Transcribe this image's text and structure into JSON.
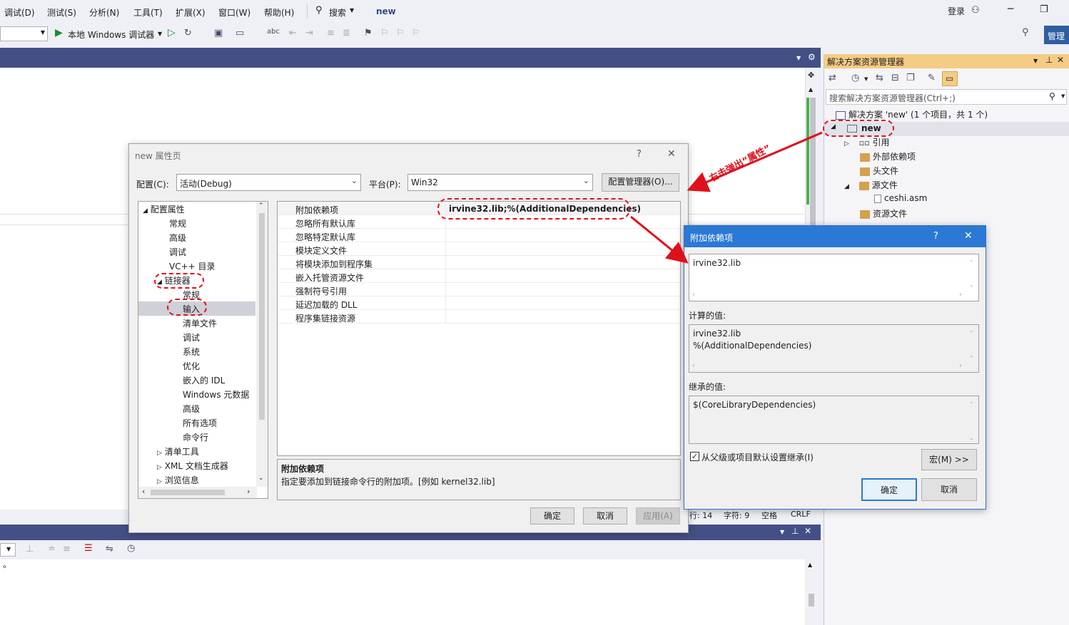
{
  "menu": [
    "调试(D)",
    "测试(S)",
    "分析(N)",
    "工具(T)",
    "扩展(X)",
    "窗口(W)",
    "帮助(H)"
  ],
  "search_label": "搜索",
  "project_name_top": "new",
  "login_label": "登录",
  "admin_label": "管理",
  "debug_target": "本地 Windows 调试器",
  "solution_explorer": {
    "title": "解决方案资源管理器",
    "search_placeholder": "搜索解决方案资源管理器(Ctrl+;)",
    "solution_row": "解决方案 'new' (1 个项目，共 1 个)",
    "project": "new",
    "items": [
      "引用",
      "外部依赖项",
      "头文件",
      "源文件",
      "ceshi.asm",
      "资源文件"
    ]
  },
  "annotation": {
    "text": "右击弹出“属性”"
  },
  "prop_dialog": {
    "title": "new 属性页",
    "help": "?",
    "close": "✕",
    "config_label": "配置(C):",
    "config_value": "活动(Debug)",
    "platform_label": "平台(P):",
    "platform_value": "Win32",
    "config_manager": "配置管理器(O)...",
    "nav": {
      "root": "配置属性",
      "general": "常规",
      "advanced": "高级",
      "debugging": "调试",
      "vcdirs": "VC++ 目录",
      "linker": "链接器",
      "linker_children": [
        "常规",
        "输入",
        "清单文件",
        "调试",
        "系统",
        "优化",
        "嵌入的 IDL",
        "Windows 元数据",
        "高级",
        "所有选项",
        "命令行"
      ],
      "manifest_tool": "清单工具",
      "xml_doc": "XML 文档生成器",
      "browse": "浏览信息"
    },
    "grid_rows": [
      {
        "name": "附加依赖项",
        "value": "irvine32.lib;%(AdditionalDependencies)"
      },
      {
        "name": "忽略所有默认库",
        "value": ""
      },
      {
        "name": "忽略特定默认库",
        "value": ""
      },
      {
        "name": "模块定义文件",
        "value": ""
      },
      {
        "name": "将模块添加到程序集",
        "value": ""
      },
      {
        "name": "嵌入托管资源文件",
        "value": ""
      },
      {
        "name": "强制符号引用",
        "value": ""
      },
      {
        "name": "延迟加载的 DLL",
        "value": ""
      },
      {
        "name": "程序集链接资源",
        "value": ""
      }
    ],
    "desc_title": "附加依赖项",
    "desc_text": "指定要添加到链接命令行的附加项。[例如 kernel32.lib]",
    "ok": "确定",
    "cancel": "取消",
    "apply": "应用(A)"
  },
  "dep_dialog": {
    "title": "附加依赖项",
    "help": "?",
    "close": "✕",
    "input_value": "irvine32.lib",
    "computed_label": "计算的值:",
    "computed_lines": [
      "irvine32.lib",
      "%(AdditionalDependencies)"
    ],
    "inherited_label": "继承的值:",
    "inherited_value": "$(CoreLibraryDependencies)",
    "inherit_checkbox": "从父级或项目默认设置继承(I)",
    "macro_button": "宏(M) >>",
    "ok": "确定",
    "cancel": "取消"
  },
  "status": {
    "line": "行: 14",
    "char": "字符: 9",
    "space": "空格",
    "crlf": "CRLF"
  },
  "output_char": "。"
}
